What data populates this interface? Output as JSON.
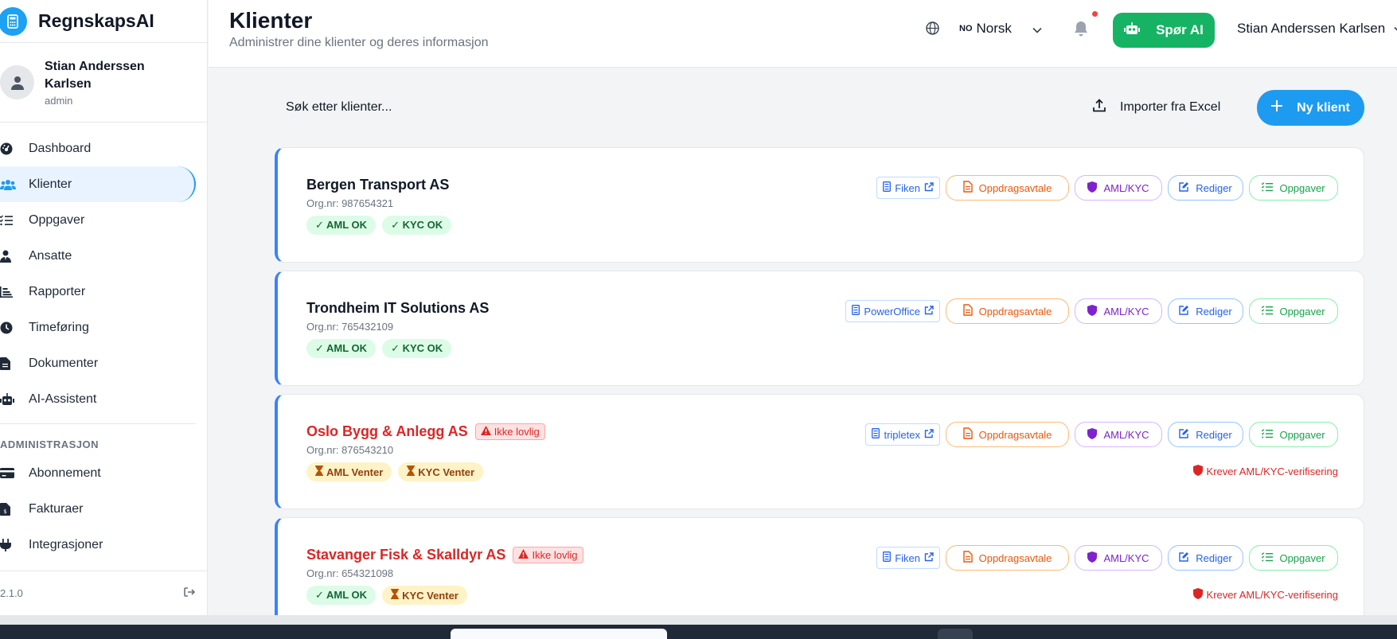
{
  "app": {
    "name": "RegnskapsAI",
    "version": "2.1.0"
  },
  "sidebar": {
    "user": {
      "name": "Stian Anderssen Karlsen",
      "role": "admin"
    },
    "items": [
      {
        "label": "Dashboard",
        "icon": "gauge-icon"
      },
      {
        "label": "Klienter",
        "icon": "users-icon",
        "active": true
      },
      {
        "label": "Oppgaver",
        "icon": "list-check-icon"
      },
      {
        "label": "Ansatte",
        "icon": "user-tie-icon"
      },
      {
        "label": "Rapporter",
        "icon": "chart-icon"
      },
      {
        "label": "Timeføring",
        "icon": "clock-icon"
      },
      {
        "label": "Dokumenter",
        "icon": "file-icon"
      },
      {
        "label": "AI-Assistent",
        "icon": "robot-icon"
      }
    ],
    "admin_section_title": "ADMINISTRASJON",
    "admin_items": [
      {
        "label": "Abonnement",
        "icon": "credit-card-icon"
      },
      {
        "label": "Fakturaer",
        "icon": "invoice-icon"
      },
      {
        "label": "Integrasjoner",
        "icon": "plug-icon"
      }
    ]
  },
  "header": {
    "title": "Klienter",
    "subtitle": "Administrer dine klienter og deres informasjon",
    "language_code": "NO",
    "language": "Norsk",
    "ask_ai": "Spør AI",
    "user_name": "Stian Anderssen Karlsen"
  },
  "toolbar": {
    "search_placeholder": "Søk etter klienter...",
    "import_label": "Importer fra Excel",
    "new_client_label": "Ny klient"
  },
  "labels": {
    "oppdragsavtale": "Oppdragsavtale",
    "aml_kyc": "AML/KYC",
    "rediger": "Rediger",
    "oppgaver": "Oppgaver",
    "ikke_lovlig": "Ikke lovlig",
    "krever": "Krever AML/KYC-verifisering"
  },
  "clients": [
    {
      "name": "Bergen Transport AS",
      "org": "Org.nr: 987654321",
      "system": "Fiken",
      "legal": true,
      "aml": "✓ AML OK",
      "aml_status": "ok",
      "kyc": "✓ KYC OK",
      "kyc_status": "ok"
    },
    {
      "name": "Trondheim IT Solutions AS",
      "org": "Org.nr: 765432109",
      "system": "PowerOffice",
      "legal": true,
      "aml": "✓ AML OK",
      "aml_status": "ok",
      "kyc": "✓ KYC OK",
      "kyc_status": "ok"
    },
    {
      "name": "Oslo Bygg & Anlegg AS",
      "org": "Org.nr: 876543210",
      "system": "tripletex",
      "legal": false,
      "aml": "AML Venter",
      "aml_status": "wait",
      "kyc": "KYC Venter",
      "kyc_status": "wait"
    },
    {
      "name": "Stavanger Fisk & Skalldyr AS",
      "org": "Org.nr: 654321098",
      "system": "Fiken",
      "legal": false,
      "aml": "✓ AML OK",
      "aml_status": "ok",
      "kyc": "KYC Venter",
      "kyc_status": "wait"
    }
  ],
  "colors": {
    "primary": "#1d9bf0",
    "success": "#16b364",
    "danger": "#dc2626"
  }
}
